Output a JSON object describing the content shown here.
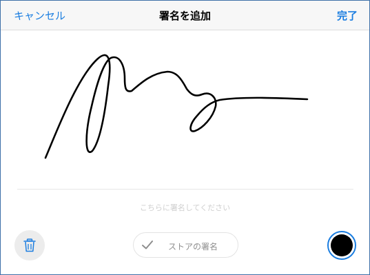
{
  "navbar": {
    "cancel_label": "キャンセル",
    "title": "署名を追加",
    "done_label": "完了"
  },
  "canvas": {
    "hint": "こちらに署名してください"
  },
  "toolbar": {
    "trash_icon": "trash-icon",
    "store_label": "ストアの署名",
    "store_icon": "checkmark-icon",
    "pen_color": "#000000"
  },
  "colors": {
    "accent": "#1a7de0"
  }
}
